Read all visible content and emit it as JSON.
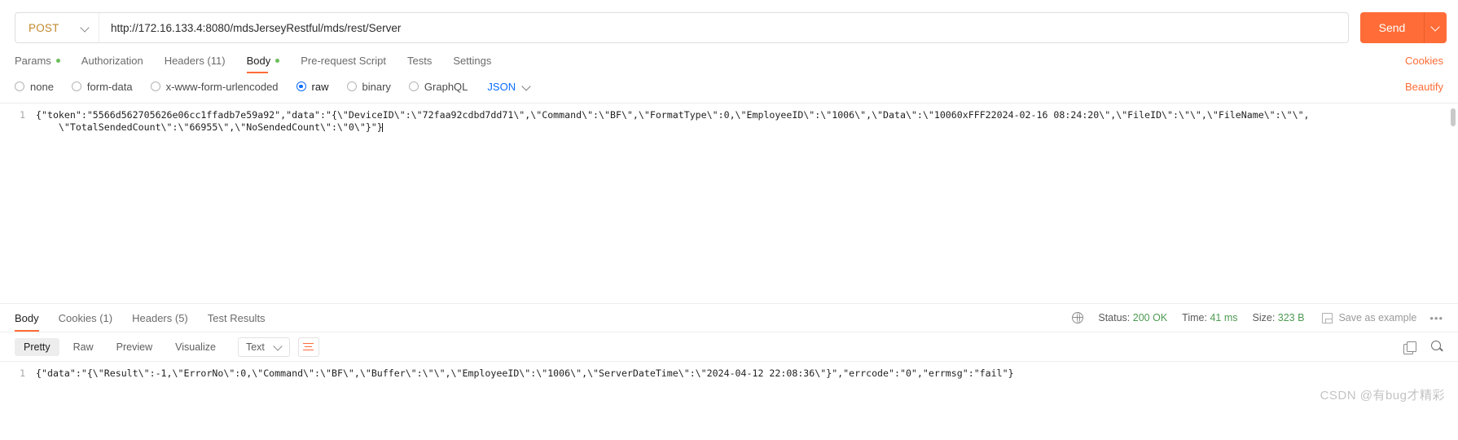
{
  "request": {
    "method": "POST",
    "url": "http://172.16.133.4:8080/mdsJerseyRestful/mds/rest/Server",
    "send_label": "Send",
    "tabs": [
      {
        "label": "Params",
        "dot": true
      },
      {
        "label": "Authorization",
        "dot": false
      },
      {
        "label": "Headers (11)",
        "dot": false
      },
      {
        "label": "Body",
        "dot": true
      },
      {
        "label": "Pre-request Script",
        "dot": false
      },
      {
        "label": "Tests",
        "dot": false
      },
      {
        "label": "Settings",
        "dot": false
      }
    ],
    "cookies_link": "Cookies",
    "body_types": [
      "none",
      "form-data",
      "x-www-form-urlencoded",
      "raw",
      "binary",
      "GraphQL"
    ],
    "selected_body_type": "raw",
    "format": "JSON",
    "beautify": "Beautify",
    "line_numbers": [
      "1"
    ],
    "body_line1_prefix": "{",
    "body_line1": "\"token\":\"5566d562705626e06cc1ffadb7e59a92\",\"data\":\"{\\\"DeviceID\\\":\\\"72faa92cdbd7dd71\\\",\\\"Command\\\":\\\"BF\\\",\\\"FormatType\\\":0,\\\"EmployeeID\\\":\\\"1006\\\",\\\"Data\\\":\\\"10060xFFF22024-02-16 08:24:20\\\",\\\"FileID\\\":\\\"\\\",\\\"FileName\\\":\\\"\\\",",
    "body_line2": "\\\"TotalSendedCount\\\":\\\"66955\\\",\\\"NoSendedCount\\\":\\\"0\\\"}\"}"
  },
  "response": {
    "tabs": [
      "Body",
      "Cookies (1)",
      "Headers (5)",
      "Test Results"
    ],
    "active_tab": "Body",
    "status_label": "Status:",
    "status_value": "200 OK",
    "time_label": "Time:",
    "time_value": "41 ms",
    "size_label": "Size:",
    "size_value": "323 B",
    "save_example": "Save as example",
    "more_menu": "•••",
    "view_modes": [
      "Pretty",
      "Raw",
      "Preview",
      "Visualize"
    ],
    "active_view_mode": "Pretty",
    "content_type": "Text",
    "line_numbers": [
      "1"
    ],
    "body": "{\"data\":\"{\\\"Result\\\":-1,\\\"ErrorNo\\\":0,\\\"Command\\\":\\\"BF\\\",\\\"Buffer\\\":\\\"\\\",\\\"EmployeeID\\\":\\\"1006\\\",\\\"ServerDateTime\\\":\\\"2024-04-12 22:08:36\\\"}\",\"errcode\":\"0\",\"errmsg\":\"fail\"}"
  },
  "watermark": "CSDN @有bug才精彩",
  "colors": {
    "accent": "#ff6c37",
    "method": "#c2892c",
    "success": "#4d9a51",
    "radio_active": "#0a6cff",
    "dot": "#6bbd5b"
  }
}
